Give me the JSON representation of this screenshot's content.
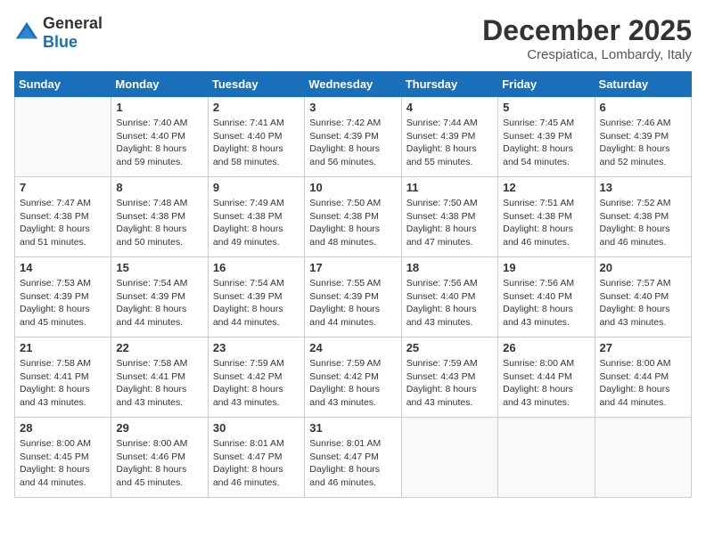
{
  "logo": {
    "general": "General",
    "blue": "Blue"
  },
  "title": {
    "month": "December 2025",
    "location": "Crespiatica, Lombardy, Italy"
  },
  "days_of_week": [
    "Sunday",
    "Monday",
    "Tuesday",
    "Wednesday",
    "Thursday",
    "Friday",
    "Saturday"
  ],
  "weeks": [
    [
      {
        "day": "",
        "info": ""
      },
      {
        "day": "1",
        "info": "Sunrise: 7:40 AM\nSunset: 4:40 PM\nDaylight: 8 hours\nand 59 minutes."
      },
      {
        "day": "2",
        "info": "Sunrise: 7:41 AM\nSunset: 4:40 PM\nDaylight: 8 hours\nand 58 minutes."
      },
      {
        "day": "3",
        "info": "Sunrise: 7:42 AM\nSunset: 4:39 PM\nDaylight: 8 hours\nand 56 minutes."
      },
      {
        "day": "4",
        "info": "Sunrise: 7:44 AM\nSunset: 4:39 PM\nDaylight: 8 hours\nand 55 minutes."
      },
      {
        "day": "5",
        "info": "Sunrise: 7:45 AM\nSunset: 4:39 PM\nDaylight: 8 hours\nand 54 minutes."
      },
      {
        "day": "6",
        "info": "Sunrise: 7:46 AM\nSunset: 4:39 PM\nDaylight: 8 hours\nand 52 minutes."
      }
    ],
    [
      {
        "day": "7",
        "info": "Sunrise: 7:47 AM\nSunset: 4:38 PM\nDaylight: 8 hours\nand 51 minutes."
      },
      {
        "day": "8",
        "info": "Sunrise: 7:48 AM\nSunset: 4:38 PM\nDaylight: 8 hours\nand 50 minutes."
      },
      {
        "day": "9",
        "info": "Sunrise: 7:49 AM\nSunset: 4:38 PM\nDaylight: 8 hours\nand 49 minutes."
      },
      {
        "day": "10",
        "info": "Sunrise: 7:50 AM\nSunset: 4:38 PM\nDaylight: 8 hours\nand 48 minutes."
      },
      {
        "day": "11",
        "info": "Sunrise: 7:50 AM\nSunset: 4:38 PM\nDaylight: 8 hours\nand 47 minutes."
      },
      {
        "day": "12",
        "info": "Sunrise: 7:51 AM\nSunset: 4:38 PM\nDaylight: 8 hours\nand 46 minutes."
      },
      {
        "day": "13",
        "info": "Sunrise: 7:52 AM\nSunset: 4:38 PM\nDaylight: 8 hours\nand 46 minutes."
      }
    ],
    [
      {
        "day": "14",
        "info": "Sunrise: 7:53 AM\nSunset: 4:39 PM\nDaylight: 8 hours\nand 45 minutes."
      },
      {
        "day": "15",
        "info": "Sunrise: 7:54 AM\nSunset: 4:39 PM\nDaylight: 8 hours\nand 44 minutes."
      },
      {
        "day": "16",
        "info": "Sunrise: 7:54 AM\nSunset: 4:39 PM\nDaylight: 8 hours\nand 44 minutes."
      },
      {
        "day": "17",
        "info": "Sunrise: 7:55 AM\nSunset: 4:39 PM\nDaylight: 8 hours\nand 44 minutes."
      },
      {
        "day": "18",
        "info": "Sunrise: 7:56 AM\nSunset: 4:40 PM\nDaylight: 8 hours\nand 43 minutes."
      },
      {
        "day": "19",
        "info": "Sunrise: 7:56 AM\nSunset: 4:40 PM\nDaylight: 8 hours\nand 43 minutes."
      },
      {
        "day": "20",
        "info": "Sunrise: 7:57 AM\nSunset: 4:40 PM\nDaylight: 8 hours\nand 43 minutes."
      }
    ],
    [
      {
        "day": "21",
        "info": "Sunrise: 7:58 AM\nSunset: 4:41 PM\nDaylight: 8 hours\nand 43 minutes."
      },
      {
        "day": "22",
        "info": "Sunrise: 7:58 AM\nSunset: 4:41 PM\nDaylight: 8 hours\nand 43 minutes."
      },
      {
        "day": "23",
        "info": "Sunrise: 7:59 AM\nSunset: 4:42 PM\nDaylight: 8 hours\nand 43 minutes."
      },
      {
        "day": "24",
        "info": "Sunrise: 7:59 AM\nSunset: 4:42 PM\nDaylight: 8 hours\nand 43 minutes."
      },
      {
        "day": "25",
        "info": "Sunrise: 7:59 AM\nSunset: 4:43 PM\nDaylight: 8 hours\nand 43 minutes."
      },
      {
        "day": "26",
        "info": "Sunrise: 8:00 AM\nSunset: 4:44 PM\nDaylight: 8 hours\nand 43 minutes."
      },
      {
        "day": "27",
        "info": "Sunrise: 8:00 AM\nSunset: 4:44 PM\nDaylight: 8 hours\nand 44 minutes."
      }
    ],
    [
      {
        "day": "28",
        "info": "Sunrise: 8:00 AM\nSunset: 4:45 PM\nDaylight: 8 hours\nand 44 minutes."
      },
      {
        "day": "29",
        "info": "Sunrise: 8:00 AM\nSunset: 4:46 PM\nDaylight: 8 hours\nand 45 minutes."
      },
      {
        "day": "30",
        "info": "Sunrise: 8:01 AM\nSunset: 4:47 PM\nDaylight: 8 hours\nand 46 minutes."
      },
      {
        "day": "31",
        "info": "Sunrise: 8:01 AM\nSunset: 4:47 PM\nDaylight: 8 hours\nand 46 minutes."
      },
      {
        "day": "",
        "info": ""
      },
      {
        "day": "",
        "info": ""
      },
      {
        "day": "",
        "info": ""
      }
    ]
  ]
}
